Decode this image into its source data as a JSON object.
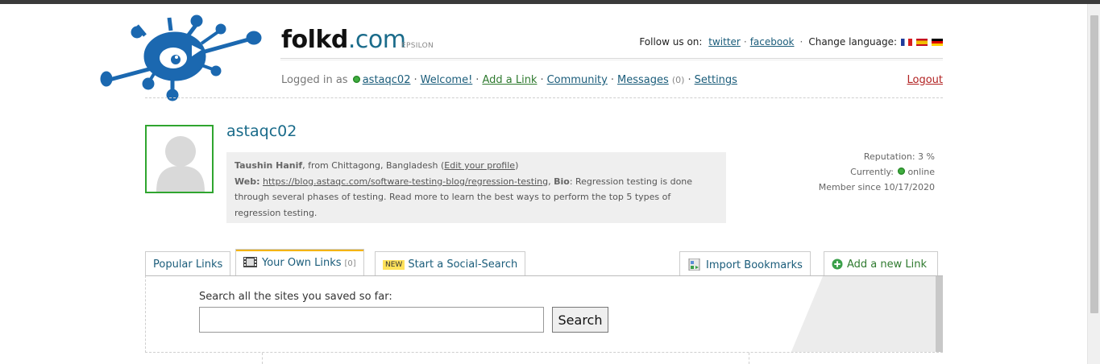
{
  "header": {
    "brand_main": "folkd",
    "brand_tld": ".com",
    "brand_sub": "EPSILON",
    "follow_label": "Follow us on:",
    "twitter": "twitter",
    "facebook": "facebook",
    "change_language": "Change language:"
  },
  "nav": {
    "logged_in_as": "Logged in as",
    "username": "astaqc02",
    "welcome": "Welcome!",
    "add_link": "Add a Link",
    "community": "Community",
    "messages": "Messages",
    "messages_count": "(0)",
    "settings": "Settings",
    "logout": "Logout"
  },
  "profile": {
    "username": "astaqc02",
    "name": "Taushin Hanif",
    "location": ", from Chittagong, Bangladesh (",
    "edit_profile": "Edit your profile",
    "web_label": "Web",
    "web_url": "https://blog.astaqc.com/software-testing-blog/regression-testing",
    "bio_label": "Bio",
    "bio_text": ": Regression testing is done through several phases of testing. Read more to learn the best ways to perform the top 5 types of regression testing.",
    "reputation": "Reputation: 3 %",
    "currently_label": "Currently:",
    "currently_value": "online",
    "member_since": "Member since 10/17/2020"
  },
  "tabs": {
    "popular": "Popular Links",
    "own": "Your Own Links",
    "own_count": "[0]",
    "new_badge": "NEW",
    "social": "Start a Social-Search",
    "import": "Import Bookmarks",
    "add_new": "Add a new Link"
  },
  "search": {
    "label": "Search all the sites you saved so far:",
    "value": "",
    "button": "Search"
  },
  "colors": {
    "link": "#1a5c7a",
    "brand_accent": "#1a6b8a",
    "online_green": "#3fae3f",
    "logout_red": "#b22222",
    "tab_active_accent": "#f4b400"
  }
}
